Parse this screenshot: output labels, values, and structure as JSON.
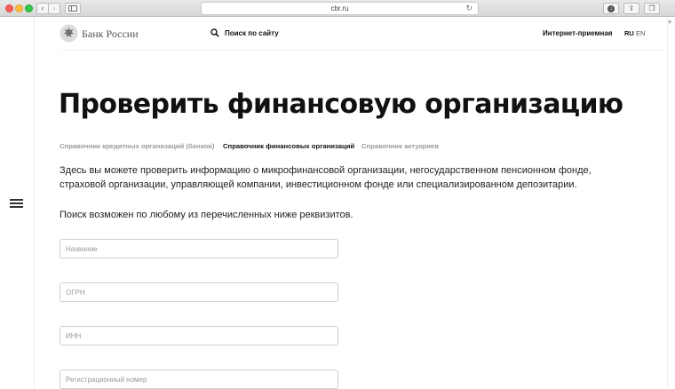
{
  "browser": {
    "url": "cbr.ru",
    "back_icon": "chevron-left",
    "forward_icon": "chevron-right",
    "reload_icon": "reload",
    "new_tab_label": "+"
  },
  "header": {
    "logo_text": "Банк России",
    "search_label": "Поиск по сайту",
    "reception_label": "Интернет-приемная",
    "lang_ru": "RU",
    "lang_en": "EN"
  },
  "main": {
    "title": "Проверить финансовую организацию",
    "tabs": [
      {
        "label": "Справочник кредитных организаций (банков)",
        "active": false
      },
      {
        "label": "Справочник финансовых организаций",
        "active": true
      },
      {
        "label": "Справочник актуариев",
        "active": false
      }
    ],
    "description": "Здесь вы можете проверить информацию о микрофинансовой организации, негосударственном пенсионном фонде, страховой организации, управляющей компании, инвестиционном фонде или специализированном депозитарии.",
    "hint": "Поиск возможен по любому из перечисленных ниже реквизитов.",
    "fields": [
      {
        "placeholder": "Название",
        "value": ""
      },
      {
        "placeholder": "ОГРН",
        "value": ""
      },
      {
        "placeholder": "ИНН",
        "value": ""
      },
      {
        "placeholder": "Регистрационный номер",
        "value": ""
      }
    ]
  },
  "colors": {
    "text": "#111111",
    "muted_tab": "#9a9a9a",
    "field_border": "#cfcfcf"
  }
}
